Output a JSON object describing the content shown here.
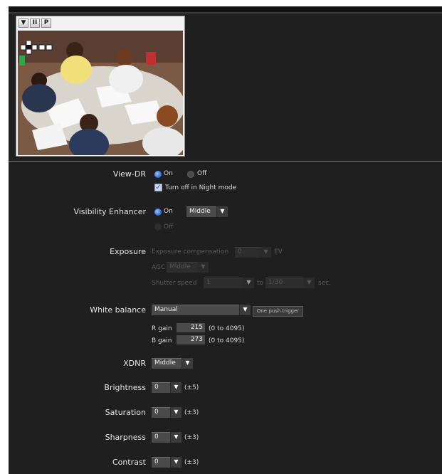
{
  "preview": {
    "buttons": [
      {
        "label": "▼"
      },
      {
        "label": "II"
      },
      {
        "label": "P"
      }
    ]
  },
  "view_dr": {
    "label": "View-DR",
    "on_label": "On",
    "off_label": "Off",
    "night_mode_label": "Turn off in Night mode"
  },
  "visibility_enhancer": {
    "label": "Visibility Enhancer",
    "on_label": "On",
    "off_label": "Off",
    "level": "Middle"
  },
  "exposure": {
    "label": "Exposure",
    "compensation_label": "Exposure compensation",
    "compensation_value": "0",
    "ev_label": "EV",
    "agc_label": "AGC",
    "agc_value": "Middle",
    "shutter_label": "Shutter speed",
    "shutter_from": "1",
    "to_label": "to",
    "shutter_to": "1/30",
    "sec_label": "sec."
  },
  "white_balance": {
    "label": "White balance",
    "mode": "Manual",
    "trigger_label": "One push trigger",
    "r_gain_label": "R gain",
    "r_gain_value": "215",
    "r_gain_range": "(0 to 4095)",
    "b_gain_label": "B gain",
    "b_gain_value": "273",
    "b_gain_range": "(0 to 4095)"
  },
  "xdnr": {
    "label": "XDNR",
    "value": "Middle"
  },
  "brightness": {
    "label": "Brightness",
    "value": "0",
    "range": "(±5)"
  },
  "saturation": {
    "label": "Saturation",
    "value": "0",
    "range": "(±3)"
  },
  "sharpness": {
    "label": "Sharpness",
    "value": "0",
    "range": "(±3)"
  },
  "contrast": {
    "label": "Contrast",
    "value": "0",
    "range": "(±3)"
  }
}
